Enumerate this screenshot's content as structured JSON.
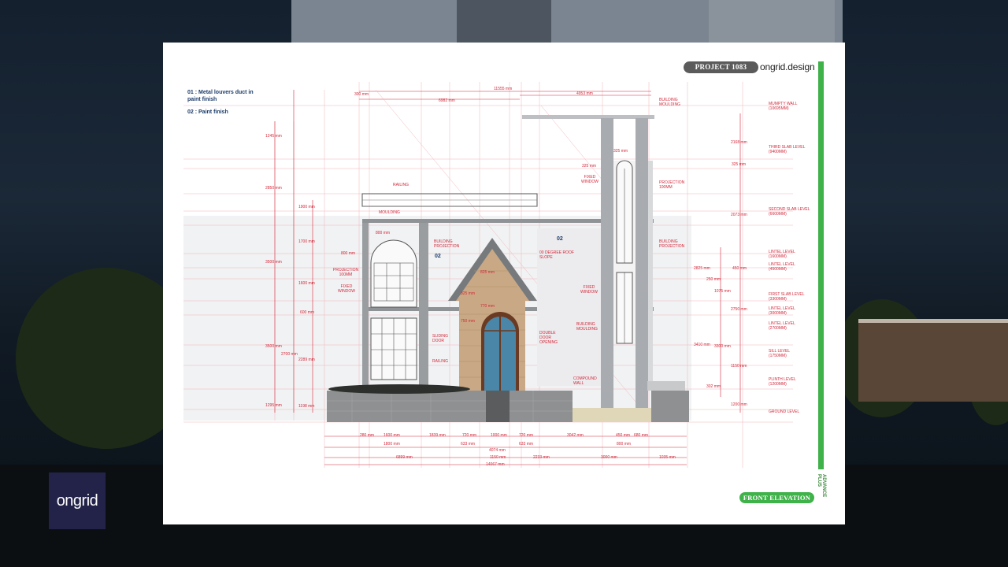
{
  "project_tag": "PROJECT 1083",
  "brand": "ongrid.design",
  "sheet_title": "FRONT ELEVATION",
  "vertical_tag": "ADVANCE PLUS",
  "logo_text": "ongrid",
  "legend": [
    "01 : Metal louvers duct in paint finish",
    "02 : Paint finish"
  ],
  "markers": [
    "02",
    "02"
  ],
  "top_dims": [
    "300 mm",
    "6982 mm",
    "11555 mm",
    "4953 mm",
    "325 mm",
    "325 mm"
  ],
  "left_dims": [
    "1245 mm",
    "2850 mm",
    "1900 mm",
    "1700 mm",
    "800 mm",
    "3500 mm",
    "1600 mm",
    "600 mm",
    "3500 mm",
    "2700 mm",
    "2289 mm",
    "1295 mm",
    "1198 mm"
  ],
  "bottom_dims": [
    "280 mm",
    "1600 mm",
    "1839 mm",
    "720 mm",
    "1000 mm",
    "720 mm",
    "3042 mm",
    "450 mm",
    "680 mm",
    "1800 mm",
    "633 mm",
    "633 mm",
    "800 mm",
    "4074 mm",
    "6899 mm",
    "1150 mm",
    "2233 mm",
    "3000 mm",
    "1035 mm",
    "14067 mm"
  ],
  "right_dims": [
    "2168 mm",
    "325 mm",
    "2073 mm",
    "2825 mm",
    "450 mm",
    "250 mm",
    "1075 mm",
    "2750 mm",
    "3410 mm",
    "3300 mm",
    "1150 mm",
    "302 mm",
    "1200 mm"
  ],
  "levels": [
    "MUMPTY WALL (10695MM)",
    "THIRD SLAB LEVEL (9400MM)",
    "SECOND SLAB LEVEL (6600MM)",
    "LINTEL LEVEL (1600MM)",
    "LINTEL LEVEL (4500MM)",
    "FIRST SLAB LEVEL (3300MM)",
    "LINTEL LEVEL (3000MM)",
    "LINTEL LEVEL (2700MM)",
    "SILL LEVEL (1750MM)",
    "PLINTH LEVEL (1200MM)",
    "GROUND LEVEL"
  ],
  "callouts": [
    "BUILDING MOULDING",
    "RAILING",
    "MOULDING",
    "FIXED WINDOW",
    "PROJECTION 100MM",
    "BUILDING PROJECTION",
    "BUILDING PROJECTION",
    "00 DEGREE ROOF SLOPE",
    "PROJECTION 100MM",
    "FIXED WINDOW",
    "FIXED WINDOW",
    "BUILDING MOULDING",
    "SLIDING DOOR",
    "DOUBLE DOOR OPENING",
    "RAILING",
    "COMPOUND WALL"
  ],
  "inner_dims": [
    "800 mm",
    "825 mm",
    "825 mm",
    "770 mm",
    "750 mm"
  ],
  "colors": {
    "dimension": "#d2283a",
    "accent_green": "#3fb24a",
    "label_blue": "#1c3c6a",
    "stone": "#c9a985"
  }
}
